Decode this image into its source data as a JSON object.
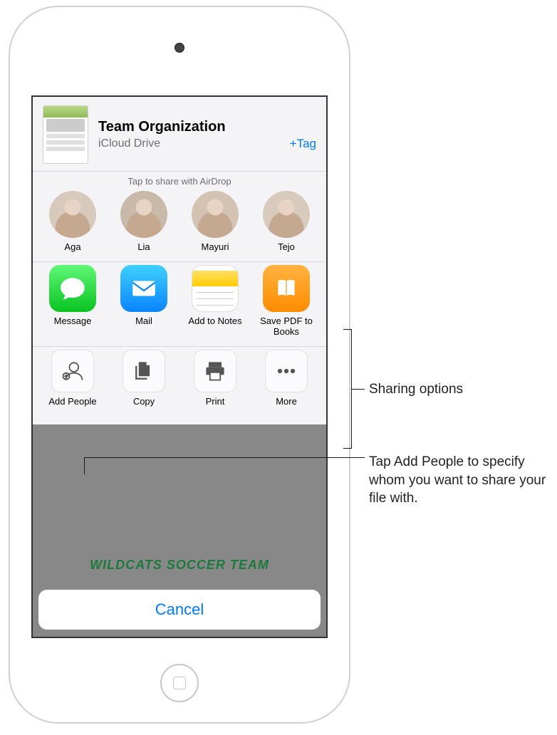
{
  "document": {
    "title": "Team Organization",
    "location": "iCloud Drive",
    "tag_button": "+Tag"
  },
  "airdrop": {
    "label": "Tap to share with AirDrop",
    "contacts": [
      {
        "name": "Aga"
      },
      {
        "name": "Lia"
      },
      {
        "name": "Mayuri"
      },
      {
        "name": "Tejo"
      }
    ]
  },
  "apps": [
    {
      "label": "Message",
      "icon": "message-icon"
    },
    {
      "label": "Mail",
      "icon": "mail-icon"
    },
    {
      "label": "Add to Notes",
      "icon": "notes-icon"
    },
    {
      "label": "Save PDF to Books",
      "icon": "books-icon"
    }
  ],
  "actions": [
    {
      "label": "Add People",
      "icon": "add-people-icon"
    },
    {
      "label": "Copy",
      "icon": "copy-icon"
    },
    {
      "label": "Print",
      "icon": "print-icon"
    },
    {
      "label": "More",
      "icon": "more-icon"
    }
  ],
  "cancel_label": "Cancel",
  "backdrop_title": "WILDCATS SOCCER TEAM",
  "callouts": {
    "sharing": "Sharing options",
    "add_people": "Tap Add People to specify whom you want to share your file with."
  }
}
